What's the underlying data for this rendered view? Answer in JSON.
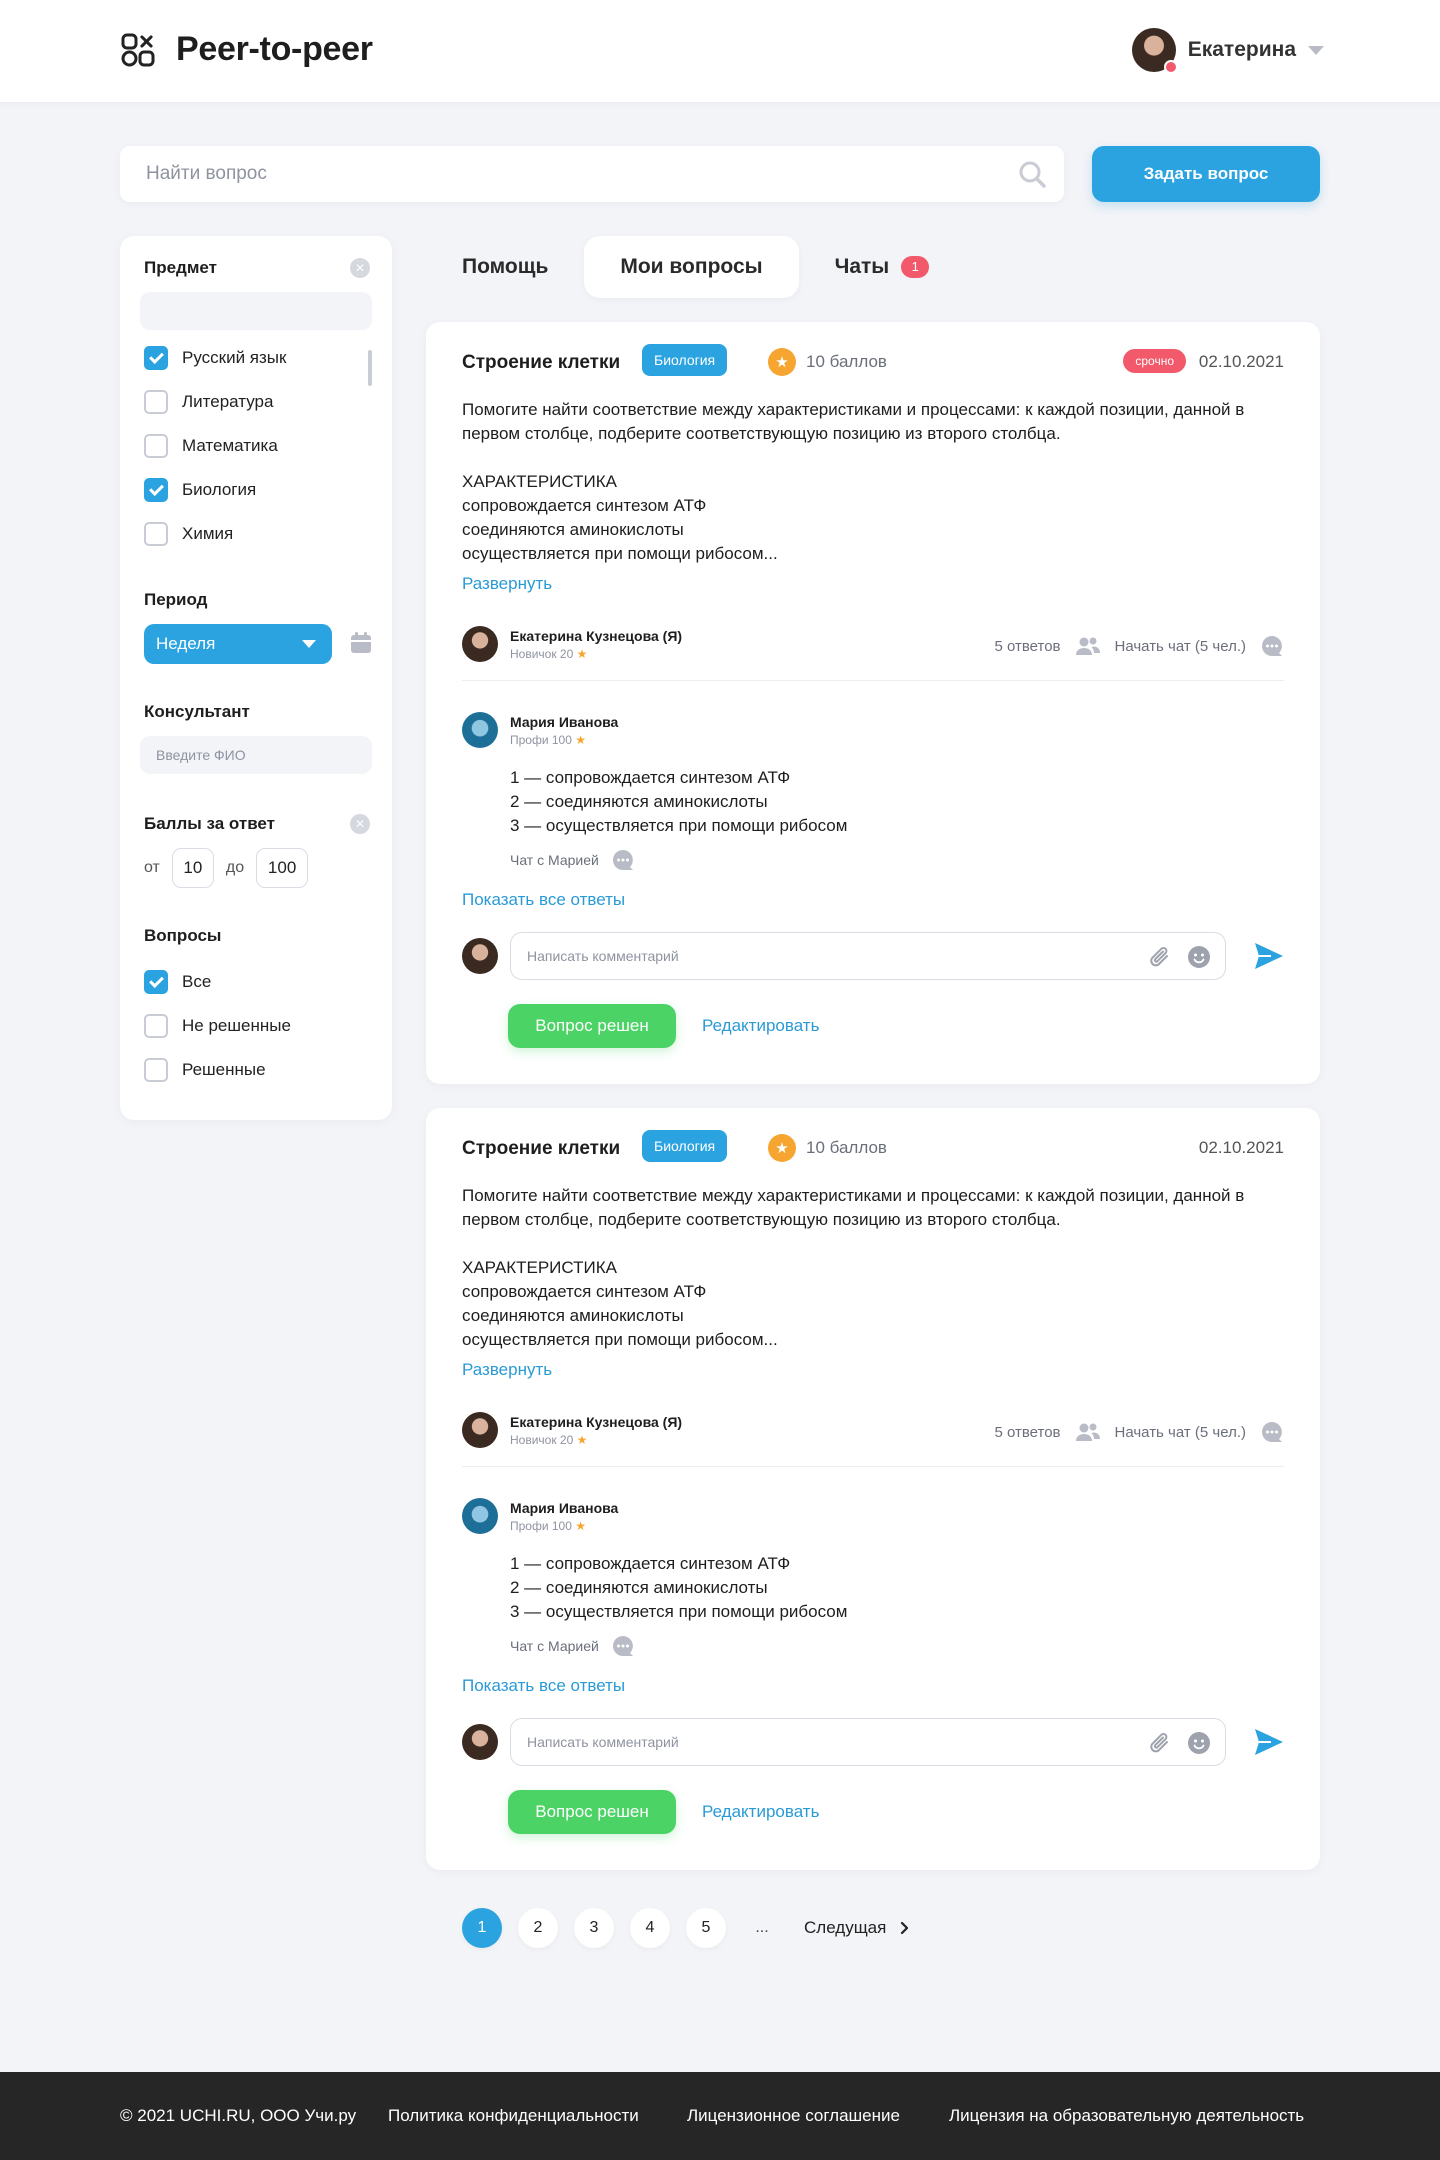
{
  "header": {
    "logo_text": "Peer-to-peer",
    "user_name": "Екатерина",
    "logo_icon": "apps-icon"
  },
  "search": {
    "placeholder": "Найти вопрос",
    "ask_button": "Задать вопрос"
  },
  "sidebar": {
    "subject_title": "Предмет",
    "subjects": [
      {
        "label": "Русский язык",
        "checked": true
      },
      {
        "label": "Литература",
        "checked": false
      },
      {
        "label": "Математика",
        "checked": false
      },
      {
        "label": "Биология",
        "checked": true
      },
      {
        "label": "Химия",
        "checked": false
      }
    ],
    "period_title": "Период",
    "period_value": "Неделя",
    "consultant_title": "Консультант",
    "consultant_placeholder": "Введите ФИО",
    "points_title": "Баллы за ответ",
    "points_from_label": "от",
    "points_from": "10",
    "points_to_label": "до",
    "points_to": "100",
    "questions_title": "Вопросы",
    "questions": [
      {
        "label": "Все",
        "checked": true
      },
      {
        "label": "Не решенные",
        "checked": false
      },
      {
        "label": "Решенные",
        "checked": false
      }
    ]
  },
  "tabs": {
    "help": "Помощь",
    "my_questions": "Мои вопросы",
    "chats": "Чаты",
    "chats_badge": "1"
  },
  "cards": [
    {
      "title": "Строение клетки",
      "tag": "Биология",
      "points": "10 баллов",
      "urgent": "срочно",
      "date": "02.10.2021",
      "body_p1": "Помогите найти соответствие между характеристиками и процессами: к каждой позиции, данной в первом столбце, подберите соответствующую позицию из второго столбца.",
      "body_lines": [
        "ХАРАКТЕРИСТИКА",
        "сопровождается синтезом АТФ",
        "соединяются аминокислоты",
        "осуществляется при помощи рибосом..."
      ],
      "expand": "Развернуть",
      "author": {
        "name": "Екатерина Кузнецова (Я)",
        "level": "Новичок 20"
      },
      "answers_count": "5 ответов",
      "start_chat": "Начать чат (5 чел.)",
      "answer": {
        "name": "Мария Иванова",
        "level": "Профи 100",
        "lines": [
          "1 — сопровождается синтезом АТФ",
          "2 — соединяются аминокислоты",
          "3 — осуществляется при помощи рибосом"
        ],
        "chat": "Чат с Марией"
      },
      "show_all": "Показать все ответы",
      "comment_placeholder": "Написать комментарий",
      "solved": "Вопрос решен",
      "edit": "Редактировать"
    },
    {
      "title": "Строение клетки",
      "tag": "Биология",
      "points": "10 баллов",
      "date": "02.10.2021",
      "body_p1": "Помогите найти соответствие между характеристиками и процессами: к каждой позиции, данной в первом столбце, подберите соответствующую позицию из второго столбца.",
      "body_lines": [
        "ХАРАКТЕРИСТИКА",
        "сопровождается синтезом АТФ",
        "соединяются аминокислоты",
        "осуществляется при помощи рибосом..."
      ],
      "expand": "Развернуть",
      "author": {
        "name": "Екатерина Кузнецова (Я)",
        "level": "Новичок 20"
      },
      "answers_count": "5 ответов",
      "start_chat": "Начать чат (5 чел.)",
      "answer": {
        "name": "Мария Иванова",
        "level": "Профи 100",
        "lines": [
          "1 — сопровождается синтезом АТФ",
          "2 — соединяются аминокислоты",
          "3 — осуществляется при помощи рибосом"
        ],
        "chat": "Чат с Марией"
      },
      "show_all": "Показать все ответы",
      "comment_placeholder": "Написать комментарий",
      "solved": "Вопрос решен",
      "edit": "Редактировать"
    }
  ],
  "pagination": {
    "pages": [
      "1",
      "2",
      "3",
      "4",
      "5"
    ],
    "active": "1",
    "dots": "...",
    "next": "Следущая"
  },
  "footer": {
    "copyright": "© 2021 UCHI.RU, ООО Учи.ру",
    "privacy": "Политика конфиденциальности",
    "license_agreement": "Лицензионное соглашение",
    "license_edu": "Лицензия на образовательную деятельность"
  },
  "colors": {
    "accent": "#2aa3e0",
    "success": "#4cd366",
    "alert": "#f25a6b",
    "star": "#f7a531"
  }
}
